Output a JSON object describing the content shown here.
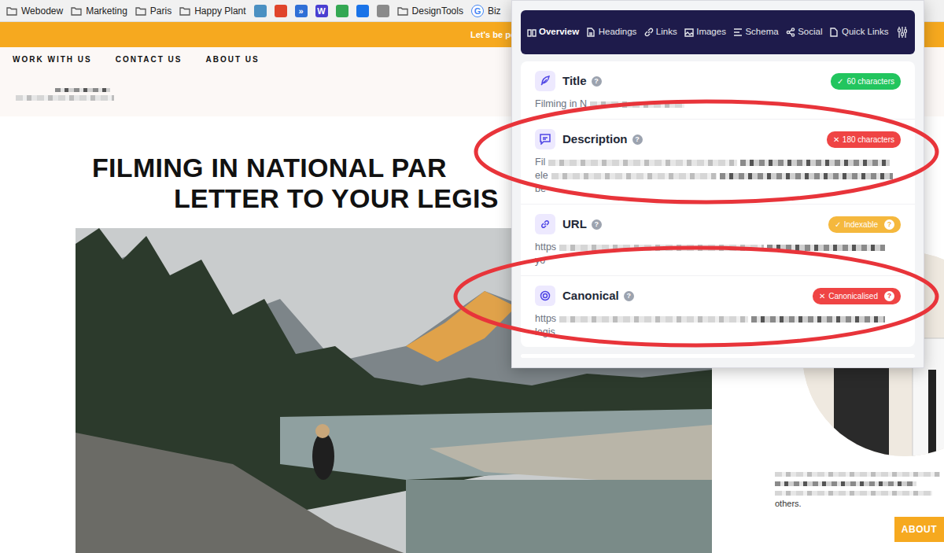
{
  "bookmarks": [
    {
      "kind": "folder",
      "label": "Webodew"
    },
    {
      "kind": "folder",
      "label": "Marketing"
    },
    {
      "kind": "folder",
      "label": "Paris"
    },
    {
      "kind": "folder",
      "label": "Happy Plant"
    },
    {
      "kind": "favicon",
      "color": "#4a90c2"
    },
    {
      "kind": "favicon",
      "color": "#e0452b"
    },
    {
      "kind": "favicon",
      "glyph": "»",
      "color": "#2f6fd6"
    },
    {
      "kind": "favicon",
      "glyph": "W",
      "color": "#4a3fd1"
    },
    {
      "kind": "favicon",
      "color": "#34a853"
    },
    {
      "kind": "favicon",
      "color": "#1a73e8"
    },
    {
      "kind": "favicon",
      "color": "#8a8a8a"
    },
    {
      "kind": "folder",
      "label": "DesignTools"
    },
    {
      "kind": "site",
      "glyph": "G",
      "color": "#4285f4",
      "label": "Biz"
    }
  ],
  "banner": {
    "text": "Let's be pe"
  },
  "nav": [
    "WORK WITH US",
    "CONTACT US",
    "ABOUT US"
  ],
  "article": {
    "heading_lines": [
      "FILMING IN NATIONAL PAR",
      "LETTER TO YOUR LEGIS"
    ]
  },
  "sidebar": {
    "text": "others.",
    "button": "ABOUT"
  },
  "extension": {
    "tabs": [
      {
        "label": "Overview",
        "selected": true
      },
      {
        "label": "Headings",
        "selected": false
      },
      {
        "label": "Links",
        "selected": false
      },
      {
        "label": "Images",
        "selected": false
      },
      {
        "label": "Schema",
        "selected": false
      },
      {
        "label": "Social",
        "selected": false
      },
      {
        "label": "Quick Links",
        "selected": false
      }
    ],
    "items": [
      {
        "label": "Title",
        "help": "?",
        "badge": {
          "icon": "✓",
          "text": "60 characters",
          "color": "#22c55e"
        },
        "lines": [
          "Filming in N"
        ]
      },
      {
        "label": "Description",
        "help": "?",
        "badge": {
          "icon": "✕",
          "text": "180 characters",
          "color": "#ef4444"
        },
        "lines": [
          "Fil",
          "ele",
          "be"
        ]
      },
      {
        "label": "URL",
        "help": "?",
        "badge": {
          "icon": "✓",
          "text": "Indexable",
          "help": "?",
          "color": "#f5b83d"
        },
        "lines": [
          "https",
          "yo"
        ]
      },
      {
        "label": "Canonical",
        "help": "?",
        "badge": {
          "icon": "✕",
          "text": "Canonicalised",
          "help": "?",
          "color": "#ef4444"
        },
        "lines": [
          "https",
          "legis"
        ]
      }
    ]
  }
}
